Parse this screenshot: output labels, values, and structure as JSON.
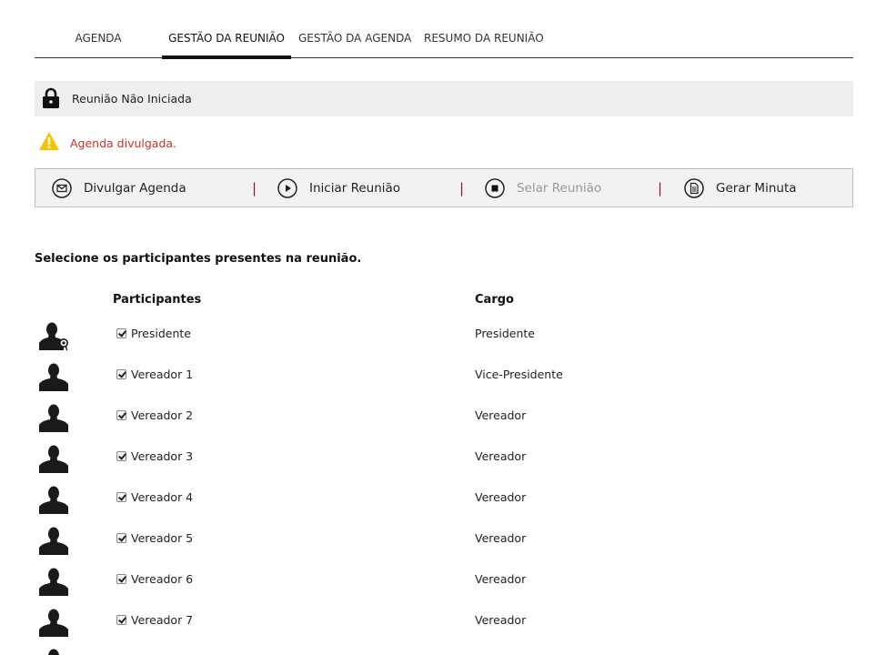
{
  "tabs": [
    {
      "label": "AGENDA",
      "active": false
    },
    {
      "label": "GESTÃO DA REUNIÃO",
      "active": true
    },
    {
      "label": "GESTÃO DA AGENDA",
      "active": false
    },
    {
      "label": "RESUMO DA REUNIÃO",
      "active": false
    }
  ],
  "status": {
    "text": "Reunião Não Iniciada",
    "icon": "lock-icon"
  },
  "warning": {
    "text": "Agenda divulgada.",
    "icon": "warning-icon",
    "color": "#c9302c"
  },
  "toolbar": {
    "divulgar": "Divulgar Agenda",
    "iniciar": "Iniciar Reunião",
    "selar": "Selar Reunião",
    "gerar": "Gerar Minuta",
    "separator": "|"
  },
  "instruction": "Selecione os participantes presentes na reunião.",
  "table": {
    "headers": {
      "participantes": "Participantes",
      "cargo": "Cargo"
    },
    "rows": [
      {
        "name": "Presidente",
        "cargo": "Presidente",
        "checked": true,
        "icon": "president-user-icon"
      },
      {
        "name": "Vereador 1",
        "cargo": "Vice-Presidente",
        "checked": true,
        "icon": "user-icon"
      },
      {
        "name": "Vereador 2",
        "cargo": "Vereador",
        "checked": true,
        "icon": "user-icon"
      },
      {
        "name": "Vereador 3",
        "cargo": "Vereador",
        "checked": true,
        "icon": "user-icon"
      },
      {
        "name": "Vereador 4",
        "cargo": "Vereador",
        "checked": true,
        "icon": "user-icon"
      },
      {
        "name": "Vereador 5",
        "cargo": "Vereador",
        "checked": true,
        "icon": "user-icon"
      },
      {
        "name": "Vereador 6",
        "cargo": "Vereador",
        "checked": true,
        "icon": "user-icon"
      },
      {
        "name": "Vereador 7",
        "cargo": "Vereador",
        "checked": true,
        "icon": "user-icon"
      }
    ]
  },
  "colors": {
    "accent": "#111111",
    "separator": "#8b1a2b",
    "warning_icon": "#f5c400",
    "status_bg": "#eeeeee"
  }
}
